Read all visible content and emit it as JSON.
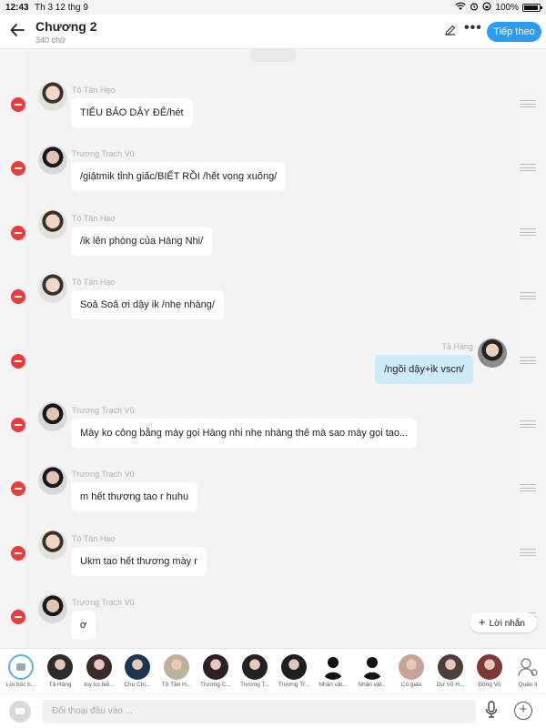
{
  "status": {
    "time": "12:43",
    "date": "Th 3 12 thg 9",
    "battery": "100%"
  },
  "header": {
    "title": "Chương 2",
    "subtitle": "340 chữ",
    "next_label": "Tiếp theo"
  },
  "messages": [
    {
      "name": "Tô Tân Hạo",
      "text": "TIỂU BẢO DẬY ĐÊ/hét",
      "self": false,
      "avatar": "toh"
    },
    {
      "name": "Trương Trạch Vũ",
      "text": "/giậtmik tỉnh giấc/BIẾT RỒI /hết vọng xuống/",
      "self": false,
      "avatar": "ttv"
    },
    {
      "name": "Tô Tân Hạo",
      "text": "/ik lên phòng của Hàng Nhi/",
      "self": false,
      "avatar": "toh"
    },
    {
      "name": "Tô Tân Hạo",
      "text": "Soả Soả ơi dậy ik /nhẹ nhàng/",
      "self": false,
      "avatar": "toh"
    },
    {
      "name": "Tả Hàng",
      "text": "/ngồi dậy+ik vscn/",
      "self": true,
      "avatar": "th"
    },
    {
      "name": "Trương Trạch Vũ",
      "text": "Mày ko công bằng mày gọi Hàng nhi nhẹ nhàng thế mà sao mày gọi tao...",
      "self": false,
      "avatar": "ttv"
    },
    {
      "name": "Trương Trạch Vũ",
      "text": "m hết thương tao r huhu",
      "self": false,
      "avatar": "ttv"
    },
    {
      "name": "Tô Tân Hạo",
      "text": "Ukm tao hết thương mày r",
      "self": false,
      "avatar": "toh"
    },
    {
      "name": "Trương Trạch Vũ",
      "text": "ơ",
      "self": false,
      "avatar": "ttv"
    }
  ],
  "add_reply_label": "Lời nhắn",
  "characters": [
    {
      "label": "Lời bốc b...",
      "color": "#dbe9f5"
    },
    {
      "label": "Tả Hàng",
      "color": "#2d2d2d"
    },
    {
      "label": "túy ko biế...",
      "color": "#3a2a2a"
    },
    {
      "label": "Chu Chí...",
      "color": "#1c3553"
    },
    {
      "label": "Tô Tân H...",
      "color": "#b9b39a"
    },
    {
      "label": "Trương C...",
      "color": "#2b1e24"
    },
    {
      "label": "Trương T...",
      "color": "#222222"
    },
    {
      "label": "Trương Tr...",
      "color": "#1e1e1e"
    },
    {
      "label": "Nhân vật...",
      "color": "#111111"
    },
    {
      "label": "Nhân vật...",
      "color": "#111111"
    },
    {
      "label": "Cô giáo",
      "color": "#c7a39a"
    },
    {
      "label": "Dư Vũ H...",
      "color": "#4b3f3c"
    },
    {
      "label": "Đồng Vũ",
      "color": "#7b3a38"
    },
    {
      "label": "Quản lí",
      "color": "#ffffff"
    }
  ],
  "input_placeholder": "Đối thoại đầu vào ...",
  "colors": {
    "accent": "#2f9bf0",
    "delete": "#ee3b3b",
    "self_bubble": "#cdeaf9"
  }
}
